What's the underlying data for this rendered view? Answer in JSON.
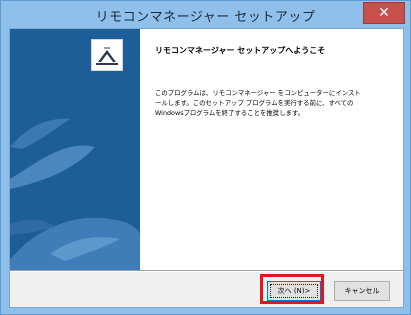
{
  "window": {
    "title": "リモコンマネージャー セットアップ"
  },
  "wizard": {
    "heading": "リモコンマネージャー セットアップへようこそ",
    "description_lines": [
      "このプログラムは、リモコンマネージャー をコンピューターにインスト",
      "ールします。このセットアップ プログラムを実行する前に、すべての",
      "Windowsプログラムを終了することを推奨します。"
    ]
  },
  "buttons": {
    "next_label": "次へ (N)>",
    "cancel_label": "キャンセル"
  },
  "icons": {
    "close": "close-icon",
    "logo": "setup-logo-icon"
  },
  "colors": {
    "titlebar": "#8fc0ec",
    "side_panel": "#1d5e99",
    "highlight": "#e8141b"
  }
}
